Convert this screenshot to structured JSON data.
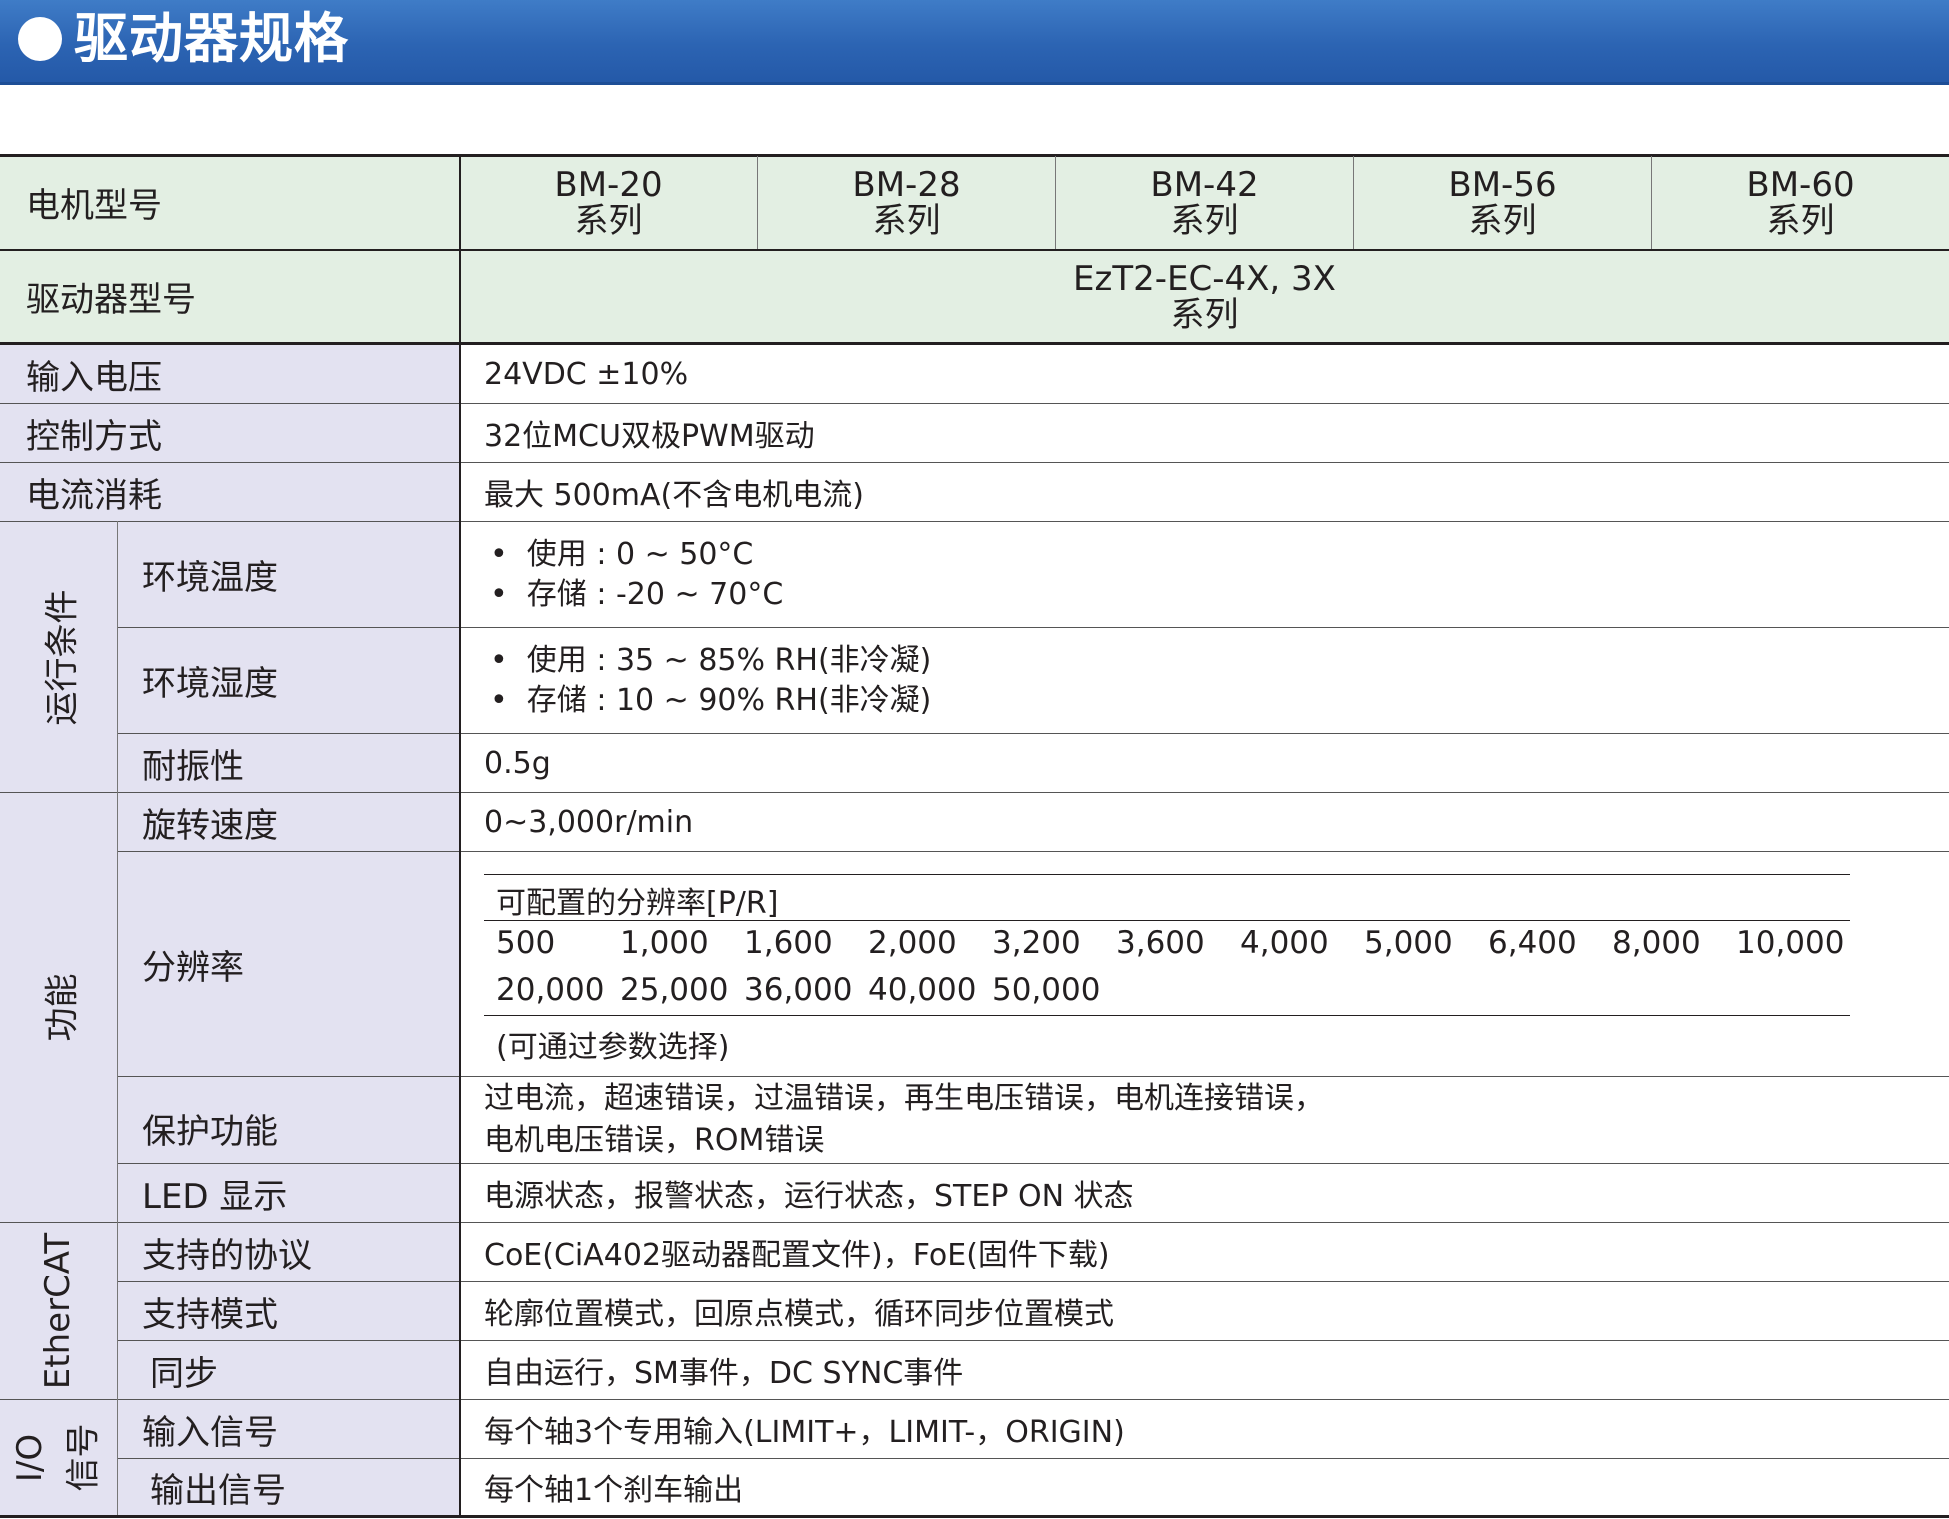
{
  "title": "驱动器规格",
  "header": {
    "motor_label": "电机型号",
    "motors": [
      {
        "model": "BM-20",
        "series": "系列"
      },
      {
        "model": "BM-28",
        "series": "系列"
      },
      {
        "model": "BM-42",
        "series": "系列"
      },
      {
        "model": "BM-56",
        "series": "系列"
      },
      {
        "model": "BM-60",
        "series": "系列"
      }
    ],
    "driver_label": "驱动器型号",
    "driver_model": "EzT2-EC-4X, 3X",
    "driver_series": "系列"
  },
  "rows": {
    "input_voltage": {
      "label": "输入电压",
      "value": "24VDC ±10%"
    },
    "control": {
      "label": "控制方式",
      "value": "32位MCU双极PWM驱动"
    },
    "current": {
      "label": "电流消耗",
      "value": "最大 500mA(不含电机电流)"
    }
  },
  "operating": {
    "group": "运行条件",
    "temp": {
      "label": "环境温度",
      "lines": [
        "使用 : 0 ~ 50°C",
        "存储 : -20 ~ 70°C"
      ]
    },
    "humidity": {
      "label": "环境湿度",
      "lines": [
        "使用 : 35 ~ 85% RH(非冷凝)",
        "存储 : 10 ~ 90% RH(非冷凝)"
      ]
    },
    "vibration": {
      "label": "耐振性",
      "value": "0.5g"
    }
  },
  "function": {
    "group": "功能",
    "speed": {
      "label": "旋转速度",
      "value": "0~3,000r/min"
    },
    "resolution": {
      "label": "分辨率",
      "table_header": "可配置的分辨率[P/R]",
      "values": [
        "500",
        "1,000",
        "1,600",
        "2,000",
        "3,200",
        "3,600",
        "4,000",
        "5,000",
        "6,400",
        "8,000",
        "10,000",
        "20,000",
        "25,000",
        "36,000",
        "40,000",
        "50,000"
      ],
      "note": "(可通过参数选择)"
    },
    "protection": {
      "label": "保护功能",
      "lines": [
        "过电流，超速错误，过温错误，再生电压错误，电机连接错误，",
        "电机电压错误，ROM错误"
      ]
    },
    "led": {
      "label": "LED 显示",
      "value": "电源状态，报警状态，运行状态，STEP ON 状态"
    }
  },
  "ethercat": {
    "group": "EtherCAT",
    "protocol": {
      "label": "支持的协议",
      "value": "CoE(CiA402驱动器配置文件)，FoE(固件下载)"
    },
    "modes": {
      "label": "支持模式",
      "value": "轮廓位置模式，回原点模式，循环同步位置模式"
    },
    "sync": {
      "label": "同步",
      "value": "自由运行，SM事件，DC SYNC事件"
    }
  },
  "io": {
    "group_a": "I/O",
    "group_b": "信号",
    "input": {
      "label": "输入信号",
      "value": "每个轴3个专用输入(LIMIT+，LIMIT-，ORIGIN)"
    },
    "output": {
      "label": "输出信号",
      "value": "每个轴1个刹车输出"
    }
  },
  "colors": {
    "banner": "#2c64b3",
    "header_bg": "#e3efe3",
    "label_bg": "#e3e2f1"
  }
}
